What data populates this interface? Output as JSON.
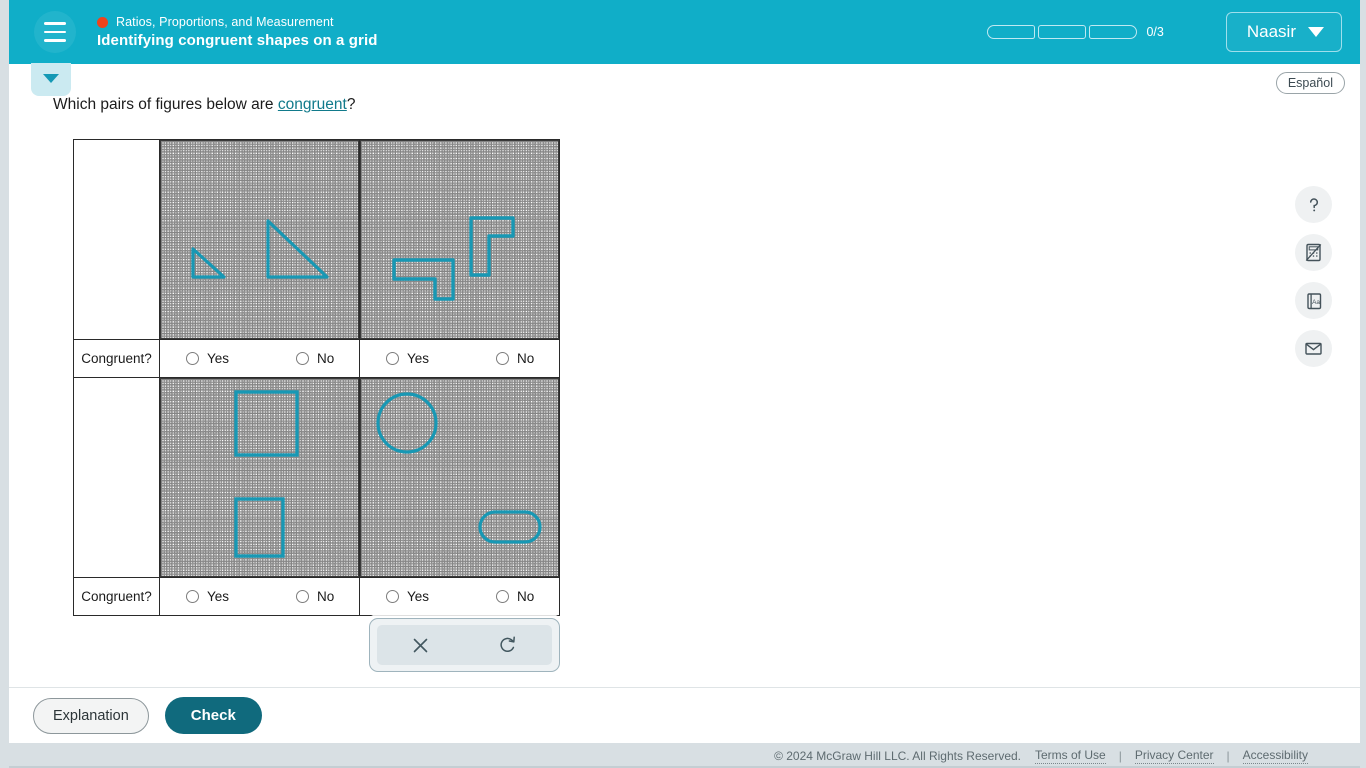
{
  "header": {
    "menu_icon": "hamburger-icon",
    "course_name": "Ratios, Proportions, and Measurement",
    "lesson_title": "Identifying congruent shapes on a grid",
    "progress_count": "0/3",
    "progress_segments": 3,
    "progress_filled": 0,
    "user_name": "Naasir",
    "user_chevron_icon": "chevron-down-icon",
    "accent_color": "#10aec8",
    "course_dot_color": "#f0431c"
  },
  "toolbar_top": {
    "collapse_icon": "chevron-down-icon",
    "espanol_label": "Español"
  },
  "question": {
    "text_before": "Which pairs of figures below are ",
    "link_text": "congruent",
    "text_after": "?"
  },
  "table": {
    "row_label": "Congruent?",
    "options": [
      "Yes",
      "No"
    ],
    "rows": [
      {
        "cells": [
          {
            "name": "triangles-grid",
            "shapes": [
              "small-right-triangle",
              "large-right-triangle"
            ]
          },
          {
            "name": "l-shapes-grid",
            "shapes": [
              "l-shape-horizontal",
              "l-shape-vertical"
            ]
          }
        ],
        "answers": [
          {
            "label": "Congruent?",
            "yes": "Yes",
            "no": "No",
            "selected": ""
          },
          {
            "label": "Congruent?",
            "yes": "Yes",
            "no": "No",
            "selected": ""
          }
        ]
      },
      {
        "cells": [
          {
            "name": "quadrilaterals-grid",
            "shapes": [
              "square",
              "rectangle"
            ]
          },
          {
            "name": "curved-shapes-grid",
            "shapes": [
              "circle",
              "stadium-rounded-rectangle"
            ]
          }
        ],
        "answers": [
          {
            "label": "Congruent?",
            "yes": "Yes",
            "no": "No",
            "selected": ""
          },
          {
            "label": "Congruent?",
            "yes": "Yes",
            "no": "No",
            "selected": ""
          }
        ]
      }
    ],
    "shape_color": "#1898b4"
  },
  "answer_toolbar": {
    "clear_icon": "close-x-icon",
    "undo_icon": "undo-rotate-icon"
  },
  "tools": [
    {
      "name": "help-icon",
      "glyph": "?"
    },
    {
      "name": "calculator-disabled-icon",
      "glyph": "calc"
    },
    {
      "name": "glossary-icon",
      "glyph": "Aa"
    },
    {
      "name": "mail-icon",
      "glyph": "envelope"
    }
  ],
  "bottom": {
    "explanation_label": "Explanation",
    "check_label": "Check",
    "check_color": "#106a7d"
  },
  "footer": {
    "copyright": "© 2024 McGraw Hill LLC. All Rights Reserved.",
    "links": [
      "Terms of Use",
      "Privacy Center",
      "Accessibility"
    ],
    "separator": "|"
  }
}
